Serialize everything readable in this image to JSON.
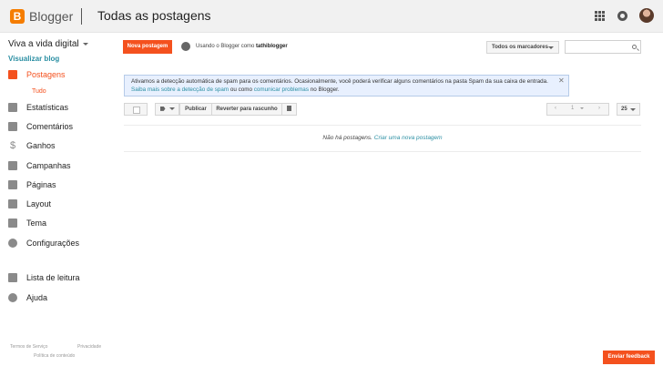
{
  "header": {
    "brand": "Blogger",
    "page_title": "Todas as postagens",
    "icons": [
      "blogger-logo-icon",
      "apps-grid-icon",
      "notifications-icon",
      "avatar"
    ]
  },
  "sidebar": {
    "blog_name": "Viva a vida digital",
    "view_blog": "Visualizar blog",
    "items": [
      {
        "label": "Postagens",
        "icon": "posts-icon",
        "active": true
      },
      {
        "label": "Estatísticas",
        "icon": "stats-icon"
      },
      {
        "label": "Comentários",
        "icon": "comments-icon"
      },
      {
        "label": "Ganhos",
        "icon": "dollar-icon"
      },
      {
        "label": "Campanhas",
        "icon": "campaigns-icon"
      },
      {
        "label": "Páginas",
        "icon": "pages-icon"
      },
      {
        "label": "Layout",
        "icon": "layout-icon"
      },
      {
        "label": "Tema",
        "icon": "theme-icon"
      },
      {
        "label": "Configurações",
        "icon": "settings-icon"
      },
      {
        "label": "Lista de leitura",
        "icon": "bookmark-icon"
      },
      {
        "label": "Ajuda",
        "icon": "help-icon"
      }
    ],
    "sub_item": "Tudo",
    "footer": {
      "terms": "Termos de Serviço",
      "privacy": "Privacidade",
      "content_policy": "Política de conteúdo"
    }
  },
  "main": {
    "new_post": "Nova postagem",
    "using_prefix": "Usando o Blogger como",
    "username": "tathiblogger",
    "labels_dropdown": "Todos os marcadores",
    "search_placeholder": "",
    "notice": {
      "text": "Ativamos a detecção automática de spam para os comentários. Ocasionalmente, você poderá verificar alguns comentários na pasta Spam da sua caixa de entrada.",
      "link1": "Saiba mais sobre a detecção de spam",
      "middle": "ou como",
      "link2": "comunicar problemas",
      "suffix": "no Blogger.",
      "close": "✕"
    },
    "toolbar": {
      "publish": "Publicar",
      "revert": "Reverter para rascunho",
      "page": "1",
      "per_page": "25"
    },
    "empty_text": "Não há postagens.",
    "empty_link": "Criar uma nova postagem",
    "feedback": "Enviar feedback"
  },
  "colors": {
    "accent": "#f4511e",
    "link": "#2b8fa3",
    "notice_bg": "#e8f0fe"
  }
}
